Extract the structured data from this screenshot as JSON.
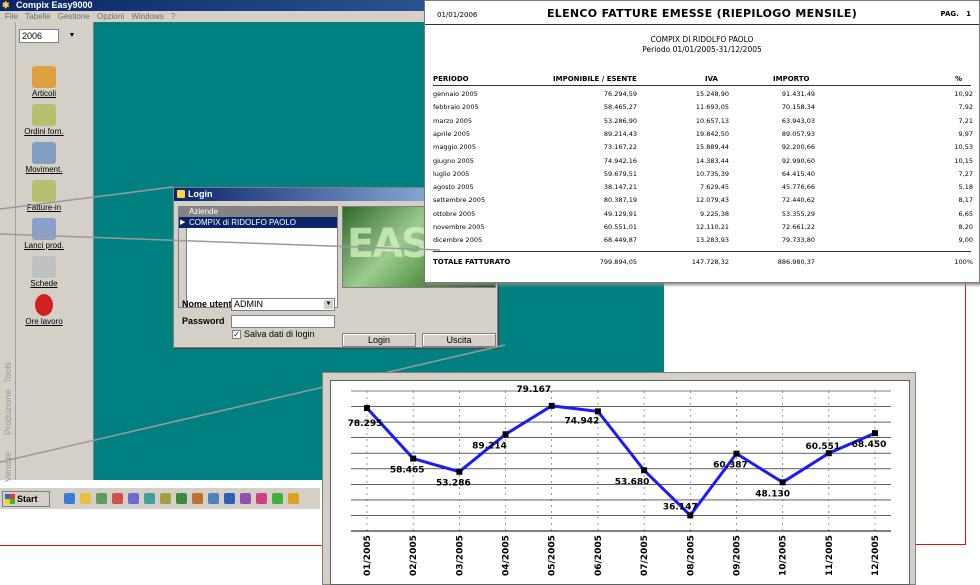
{
  "app": {
    "title": "Compix Easy9000",
    "menu": [
      "File",
      "Tabelle",
      "Gestione",
      "Opzioni",
      "Windows",
      "?"
    ],
    "year_select": "2006",
    "vertical_tabs": [
      "Tools",
      "Produzione",
      "Vendite"
    ],
    "tools": [
      {
        "label": "Articoli",
        "icon": "box-icon",
        "color": "#e0a040"
      },
      {
        "label": "Ordini forn.",
        "icon": "pencil-check-icon",
        "color": "#b8c070"
      },
      {
        "label": "Moviment.",
        "icon": "truck-icon",
        "color": "#7fa0c0"
      },
      {
        "label": "Fatture-in",
        "icon": "pencil-check-icon",
        "color": "#b8c070"
      },
      {
        "label": "Lanci prod.",
        "icon": "gears-icon",
        "color": "#8aa0c8"
      },
      {
        "label": "Schede",
        "icon": "tool-icon",
        "color": "#c0c0c0"
      },
      {
        "label": "Ore lavoro",
        "icon": "alarm-clock-icon",
        "color": "#d02020"
      }
    ],
    "start_label": "Start"
  },
  "login": {
    "title": "Login",
    "grid_header": "Aziende",
    "company": "COMPIX di RIDOLFO PAOLO",
    "logo_text": "EASY",
    "user_label": "Nome utente",
    "user_value": "ADMIN",
    "password_label": "Password",
    "save_label": "Salva dati di login",
    "save_checked": true,
    "login_button": "Login",
    "exit_button": "Uscita"
  },
  "report": {
    "date": "01/01/2006",
    "title": "ELENCO FATTURE EMESSE (RIEPILOGO MENSILE)",
    "page_label": "PAG.",
    "page_no": "1",
    "company": "COMPIX DI RIDOLFO PAOLO",
    "period": "Periodo 01/01/2005-31/12/2005",
    "headers": [
      "PERIODO",
      "IMPONIBILE / ESENTE",
      "IVA",
      "IMPORTO",
      "%"
    ],
    "rows": [
      [
        "gennaio 2005",
        "76.294,59",
        "15.248,90",
        "91.431,49",
        "10,92"
      ],
      [
        "febbraio 2005",
        "58.465,27",
        "11.693,05",
        "70.158,34",
        "7,92"
      ],
      [
        "marzo 2005",
        "53.286,90",
        "10.657,13",
        "63.943,03",
        "7,21"
      ],
      [
        "aprile 2005",
        "89.214,43",
        "19.842,50",
        "89.057,93",
        "9,97"
      ],
      [
        "maggio 2005",
        "73.167,22",
        "15.889,44",
        "92.200,66",
        "10,53"
      ],
      [
        "giugno 2005",
        "74.942,16",
        "14.383,44",
        "92.990,60",
        "10,15"
      ],
      [
        "luglio 2005",
        "59.679,51",
        "10.735,39",
        "64.415,40",
        "7,27"
      ],
      [
        "agosto 2005",
        "38.147,21",
        "7.629,45",
        "45.776,66",
        "5,18"
      ],
      [
        "settembre 2005",
        "80.387,19",
        "12.079,43",
        "72.440,62",
        "8,17"
      ],
      [
        "ottobre 2005",
        "49.129,91",
        "9.225,38",
        "53.355,29",
        "6,65"
      ],
      [
        "novembre 2005",
        "60.551,01",
        "12.110,21",
        "72.661,22",
        "8,20"
      ],
      [
        "dicembre 2005",
        "68.449,87",
        "13.283,93",
        "79.733,80",
        "9,00"
      ]
    ],
    "total_label": "TOTALE FATTURATO",
    "total": [
      "799.894,05",
      "147.728,32",
      "886.980,37",
      "100%"
    ]
  },
  "chart_data": {
    "type": "line",
    "x": [
      "01/2005",
      "02/2005",
      "03/2005",
      "04/2005",
      "05/2005",
      "06/2005",
      "07/2005",
      "08/2005",
      "09/2005",
      "10/2005",
      "11/2005",
      "12/2005"
    ],
    "y_display": [
      78295,
      58465,
      53286,
      68000,
      79167,
      77000,
      53860,
      36147,
      60387,
      49130,
      60551,
      68450
    ],
    "labels": [
      "78.295",
      "58.465",
      "53.286",
      "89.214",
      "79.167",
      "74.942",
      "53.680",
      "36.147",
      "60.387",
      "48.130",
      "60.551",
      "68.450"
    ],
    "line_color": "#1a1aff",
    "grid": true
  }
}
